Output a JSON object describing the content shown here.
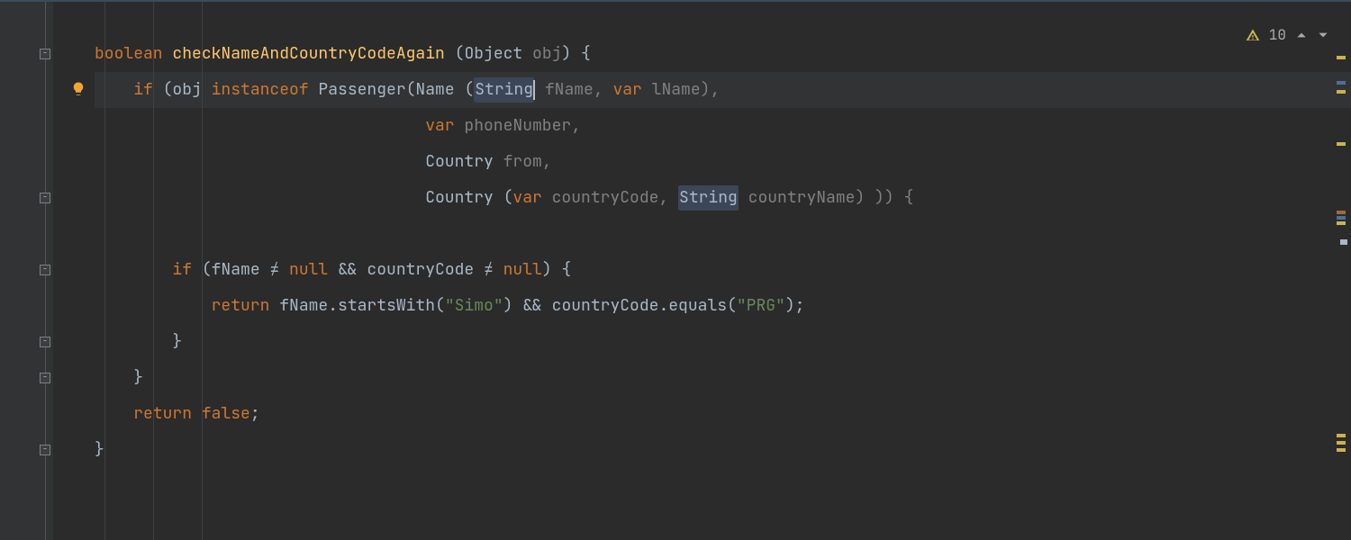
{
  "annotations": {
    "warning_count": "10"
  },
  "code": {
    "kw_boolean": "boolean",
    "method_name": "checkNameAndCountryCodeAgain",
    "sig_open": " (",
    "type_Object": "Object",
    "param_obj": " obj",
    "sig_close": ") {",
    "kw_if": "if",
    "l2_open": " (obj ",
    "kw_instanceof": "instanceof",
    "l2_passenger": " Passenger(Name (",
    "type_String": "String",
    "l2_fname": " fName, ",
    "kw_var": "var",
    "l2_lname": " lName),",
    "indent_args": "                                  ",
    "l3_phone": " phoneNumber,",
    "type_Country": "Country",
    "l4_from": " from,",
    "l5_open": " (",
    "l5_cc": " countryCode, ",
    "l5_cn": " countryName) )) {",
    "l6_cond": " (fName ≠ ",
    "kw_null": "null",
    "l6_and": " && countryCode ≠ ",
    "l6_close": ") {",
    "kw_return": "return",
    "l7_a": " fName.startsWith(",
    "str_simo": "\"Simo\"",
    "l7_b": ") && countryCode.equals(",
    "str_prg": "\"PRG\"",
    "l7_c": ");",
    "brace_close": "}",
    "l9_return": " ",
    "kw_false": "false",
    "semi": ";"
  }
}
